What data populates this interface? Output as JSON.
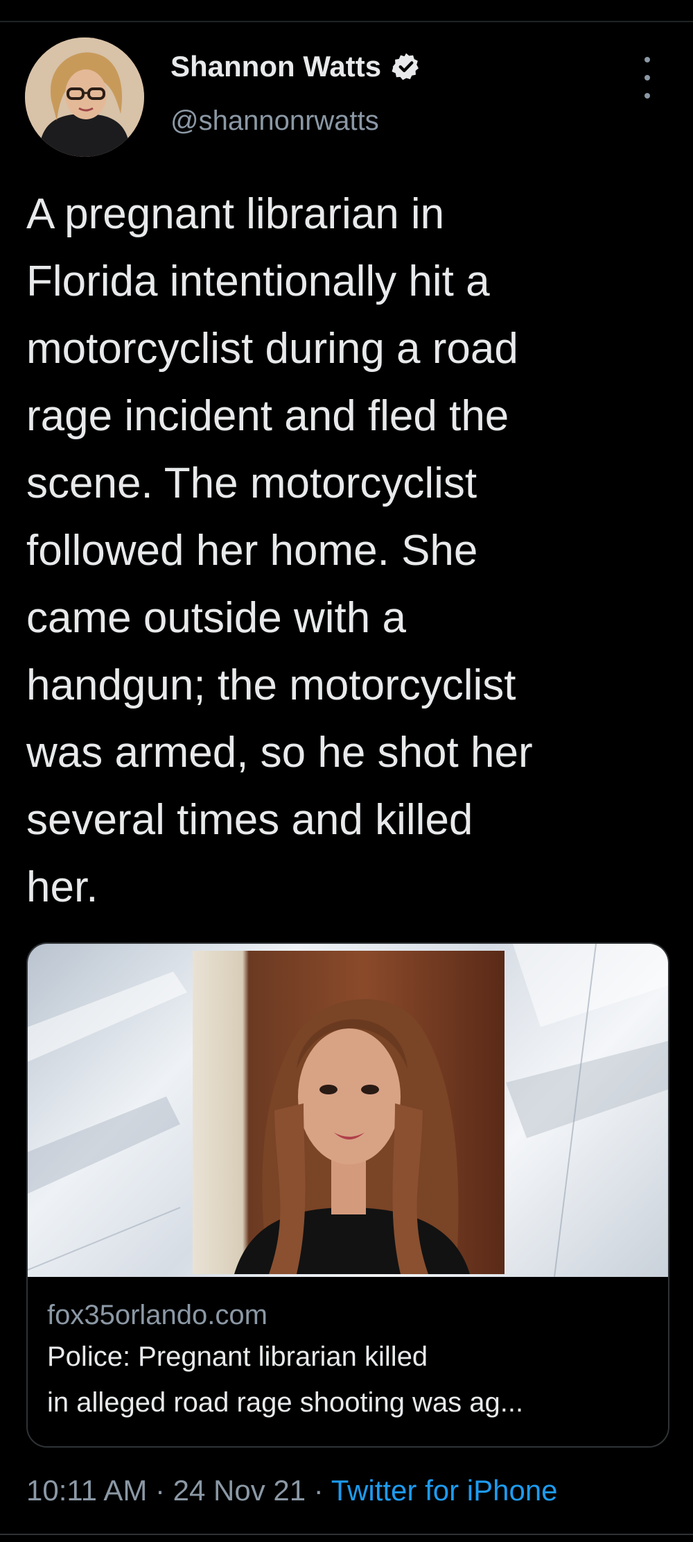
{
  "tweet": {
    "author": {
      "display_name": "Shannon Watts",
      "handle": "@shannonrwatts",
      "verified": true,
      "avatar_icon": "avatar-photo"
    },
    "text": "A pregnant librarian in\nFlorida intentionally hit a\nmotorcyclist during a road\nrage incident and fled the\nscene. The motorcyclist\nfollowed her home. She\ncame outside with a\nhandgun; the motorcyclist\nwas armed, so he shot her\nseveral times and killed\nher.",
    "card": {
      "domain": "fox35orlando.com",
      "title": "Police: Pregnant librarian killed\nin alleged road rage shooting was ag..."
    },
    "meta": {
      "time": "10:11 AM",
      "separator": " · ",
      "date": "24 Nov 21",
      "source": "Twitter for iPhone"
    }
  },
  "colors": {
    "background": "#000000",
    "text": "#e7e9ea",
    "secondary": "#8b98a5",
    "accent": "#1d9bf0"
  }
}
